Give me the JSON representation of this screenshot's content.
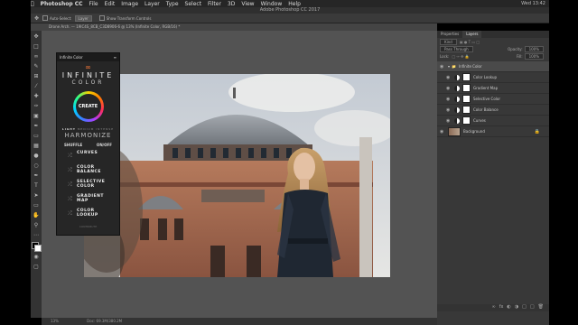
{
  "menubar": {
    "app_name": "Photoshop CC",
    "items": [
      "File",
      "Edit",
      "Image",
      "Layer",
      "Type",
      "Select",
      "Filter",
      "3D",
      "View",
      "Window",
      "Help"
    ],
    "right": "Wed 13:42"
  },
  "window_title": "Adobe Photoshop CC 2017",
  "options_bar": {
    "auto_select_label": "Auto-Select:",
    "auto_select_value": "Layer",
    "show_transform_label": "Show Transform Controls"
  },
  "document_tab": "Drone Arch. — 19IC4S_8CB_C3D8906-6 @ 13% (Infinite Color, RGB/16) *",
  "status": {
    "zoom": "13%",
    "doc": "Doc: 69.3M/380.2M"
  },
  "plugin": {
    "title": "Infinite Color",
    "logo_word": "INFINITE",
    "logo_sub": "COLOR",
    "create_label": "CREATE",
    "intensity": [
      "LIGHT",
      "MEDIUM",
      "INTENSE"
    ],
    "harmonize": "HARMONIZE",
    "shuffle": "SHUFFLE",
    "onoff": "ON/OFF",
    "rows": [
      {
        "label": "CURVES"
      },
      {
        "label": "COLOR BALANCE"
      },
      {
        "label": "SELECTIVE COLOR"
      },
      {
        "label": "GRADIENT MAP"
      },
      {
        "label": "COLOR LOOKUP"
      }
    ],
    "footer": "CONTRIBUTE"
  },
  "panels": {
    "tabs": [
      "Properties",
      "Layers"
    ],
    "kind_label": "Kind",
    "blend_mode": "Pass Through",
    "opacity_label": "Opacity:",
    "opacity_value": "100%",
    "lock_label": "Lock:",
    "fill_label": "Fill:",
    "fill_value": "100%",
    "layers": [
      {
        "name": "Infinite Color",
        "type": "group",
        "selected": true
      },
      {
        "name": "Color Lookup",
        "type": "adj"
      },
      {
        "name": "Gradient Map",
        "type": "adj"
      },
      {
        "name": "Selective Color",
        "type": "adj"
      },
      {
        "name": "Color Balance",
        "type": "adj"
      },
      {
        "name": "Curves",
        "type": "adj"
      },
      {
        "name": "Background",
        "type": "bg"
      }
    ]
  }
}
